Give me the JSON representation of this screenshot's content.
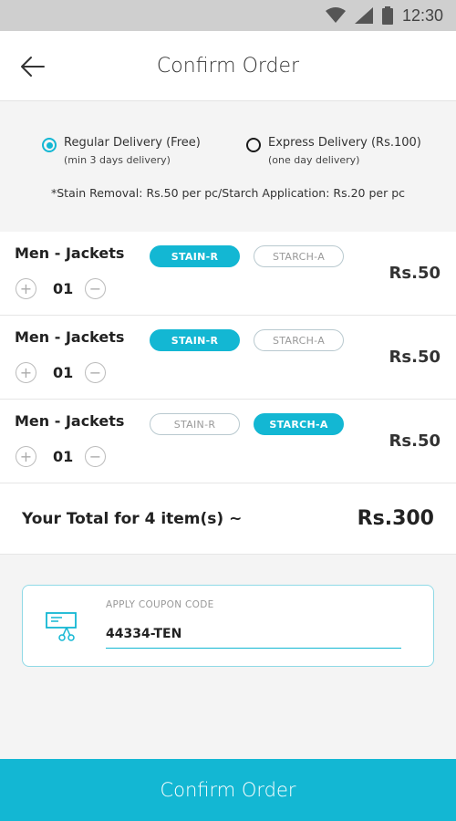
{
  "status_bar": {
    "time": "12:30",
    "icons": [
      "wifi-icon",
      "signal-icon",
      "battery-icon"
    ]
  },
  "header": {
    "back_icon": "arrow-left-icon",
    "title": "Confirm Order"
  },
  "delivery": {
    "options": [
      {
        "label": "Regular Delivery (Free)",
        "sub": "(min 3 days delivery)",
        "selected": true
      },
      {
        "label": "Express Delivery (Rs.100)",
        "sub": "(one day delivery)",
        "selected": false
      }
    ],
    "note": "*Stain Removal: Rs.50 per pc/Starch Application: Rs.20 per pc"
  },
  "addon_labels": {
    "stain": "STAIN-R",
    "starch": "STARCH-A"
  },
  "items": [
    {
      "name": "Men - Jackets",
      "qty": "01",
      "price": "Rs.50",
      "stain_active": true,
      "starch_active": false
    },
    {
      "name": "Men - Jackets",
      "qty": "01",
      "price": "Rs.50",
      "stain_active": true,
      "starch_active": false
    },
    {
      "name": "Men - Jackets",
      "qty": "01",
      "price": "Rs.50",
      "stain_active": false,
      "starch_active": true
    }
  ],
  "total": {
    "label": "Your Total for 4 item(s) ~",
    "value": "Rs.300"
  },
  "coupon": {
    "icon": "coupon-scissors-icon",
    "label": "APPLY COUPON CODE",
    "value": "44334-TEN"
  },
  "confirm_button": {
    "label": "Confirm Order"
  },
  "colors": {
    "accent": "#13b7d3"
  }
}
